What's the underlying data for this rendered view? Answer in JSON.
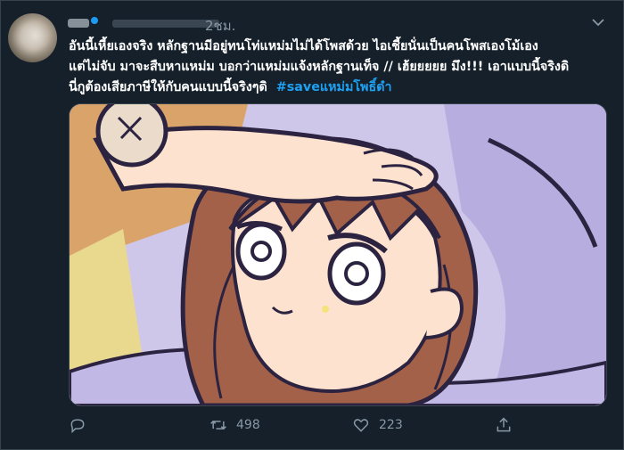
{
  "tweet": {
    "time": "2ชม.",
    "lines": [
      "อันนี้เหี้ยเองจริง หลักฐานมีอยู่ทนโท่แหม่มไม่ได้โพสด้วย ไอเชี้ยนั่นเป็นคนโพสเองโม้เอง",
      "แต่ไม่จับ มาจะสืบหาแหม่ม บอกว่าแหม่มแจ้งหลักฐานเท็จ // เฮ้ยยยยย มึง!!! เอาแบบนี้จริงดิ",
      "นี่กูต้องเสียภาษีให้กับคนแบบนี้จริงๆดิ"
    ],
    "hashtag": "#saveแหม่มโพธิ์ดำ"
  },
  "actions": {
    "retweets": "498",
    "likes": "223"
  },
  "icons": {
    "reply": "reply-icon",
    "retweet": "retweet-icon",
    "like": "heart-icon",
    "share": "share-icon",
    "more": "chevron-down-icon"
  },
  "colors": {
    "background": "#15202b",
    "text": "#ffffff",
    "muted": "#8899a6",
    "link": "#1da1f2"
  }
}
